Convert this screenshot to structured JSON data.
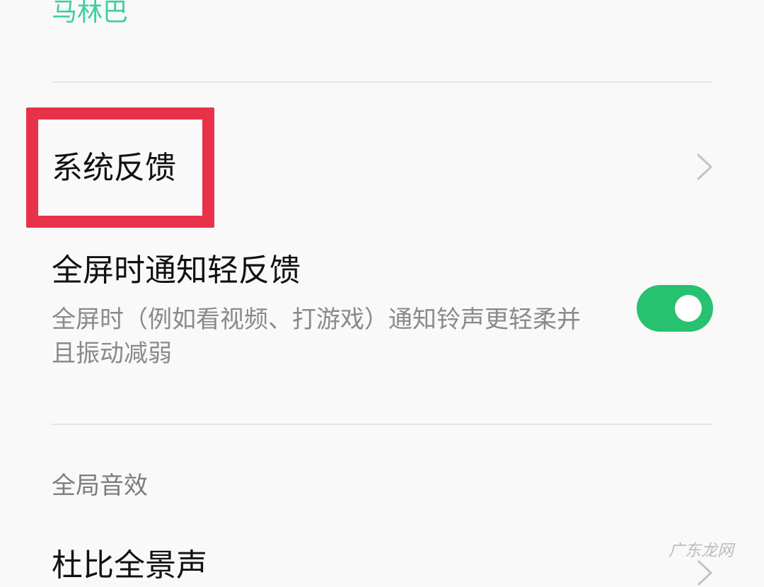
{
  "ringtone": {
    "value": "马林巴"
  },
  "system_feedback": {
    "label": "系统反馈"
  },
  "fullscreen_notify": {
    "title": "全屏时通知轻反馈",
    "description": "全屏时（例如看视频、打游戏）通知铃声更轻柔并且振动减弱",
    "enabled": true
  },
  "global_audio": {
    "section_header": "全局音效",
    "dolby_label": "杜比全景声"
  },
  "watermark": {
    "text": "广东龙网"
  },
  "colors": {
    "accent_green": "#26c270",
    "ringtone_green": "#3fcf9a",
    "highlight_red": "#e8324a"
  },
  "icons": {
    "chevron": "chevron-right-icon"
  }
}
